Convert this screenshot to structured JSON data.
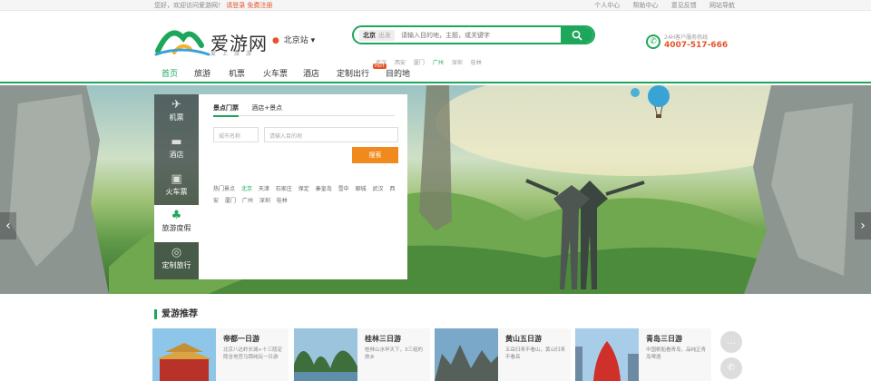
{
  "topbar": {
    "welcome": "您好，欢迎访问爱游网！",
    "login": "请登录",
    "register": "免费注册",
    "links": [
      "个人中心",
      "帮助中心",
      "意见反馈",
      "网站导航"
    ]
  },
  "header": {
    "logo_text": "爱游网",
    "logo_sub": "爱上旅游",
    "city": "北京站",
    "search_scope": "北京",
    "search_scope_alt": "出发",
    "search_placeholder": "请输入目的地，主题，或关键字",
    "hot_words": [
      "武汉",
      "西安",
      "厦门",
      "广州",
      "深圳",
      "桂林"
    ],
    "service_label": "24H客户服务热线",
    "service_phone": "4007-517-666"
  },
  "nav": {
    "items": [
      "首页",
      "旅游",
      "机票",
      "火车票",
      "酒店",
      "定制出行",
      "目的地"
    ],
    "hot_badge": "HOT"
  },
  "booking": {
    "side_tabs": [
      "机票",
      "酒店",
      "火车票",
      "旅游度假",
      "定制旅行"
    ],
    "panel_tabs": [
      "景点门票",
      "酒店+景点"
    ],
    "city_placeholder": "城市名称",
    "dest_placeholder": "请输入目的地",
    "search_button": "搜索",
    "hot_label": "热门景点",
    "hot_spots": [
      "北京",
      "天津",
      "石家庄",
      "保定",
      "秦皇岛",
      "雪中",
      "聊城",
      "武汉",
      "西安",
      "厦门",
      "广州",
      "深圳",
      "桂林"
    ]
  },
  "recommend": {
    "title": "爱游推荐",
    "cards": [
      {
        "title": "帝都一日游",
        "desc": "北京八达岭长城+十三陵定陵含地宫马蹄纯玩一日游"
      },
      {
        "title": "桂林三日游",
        "desc": "桂林山水甲天下，3三组的旅乡"
      },
      {
        "title": "黄山五日游",
        "desc": "五岳归来不看山，黄山归来不看岳"
      },
      {
        "title": "青岛三日游",
        "desc": "中国帆船看青岛，品纯正青岛啤酒"
      }
    ]
  },
  "colors": {
    "accent": "#1ea75a",
    "orange": "#f08a1c",
    "red": "#e5542a"
  }
}
